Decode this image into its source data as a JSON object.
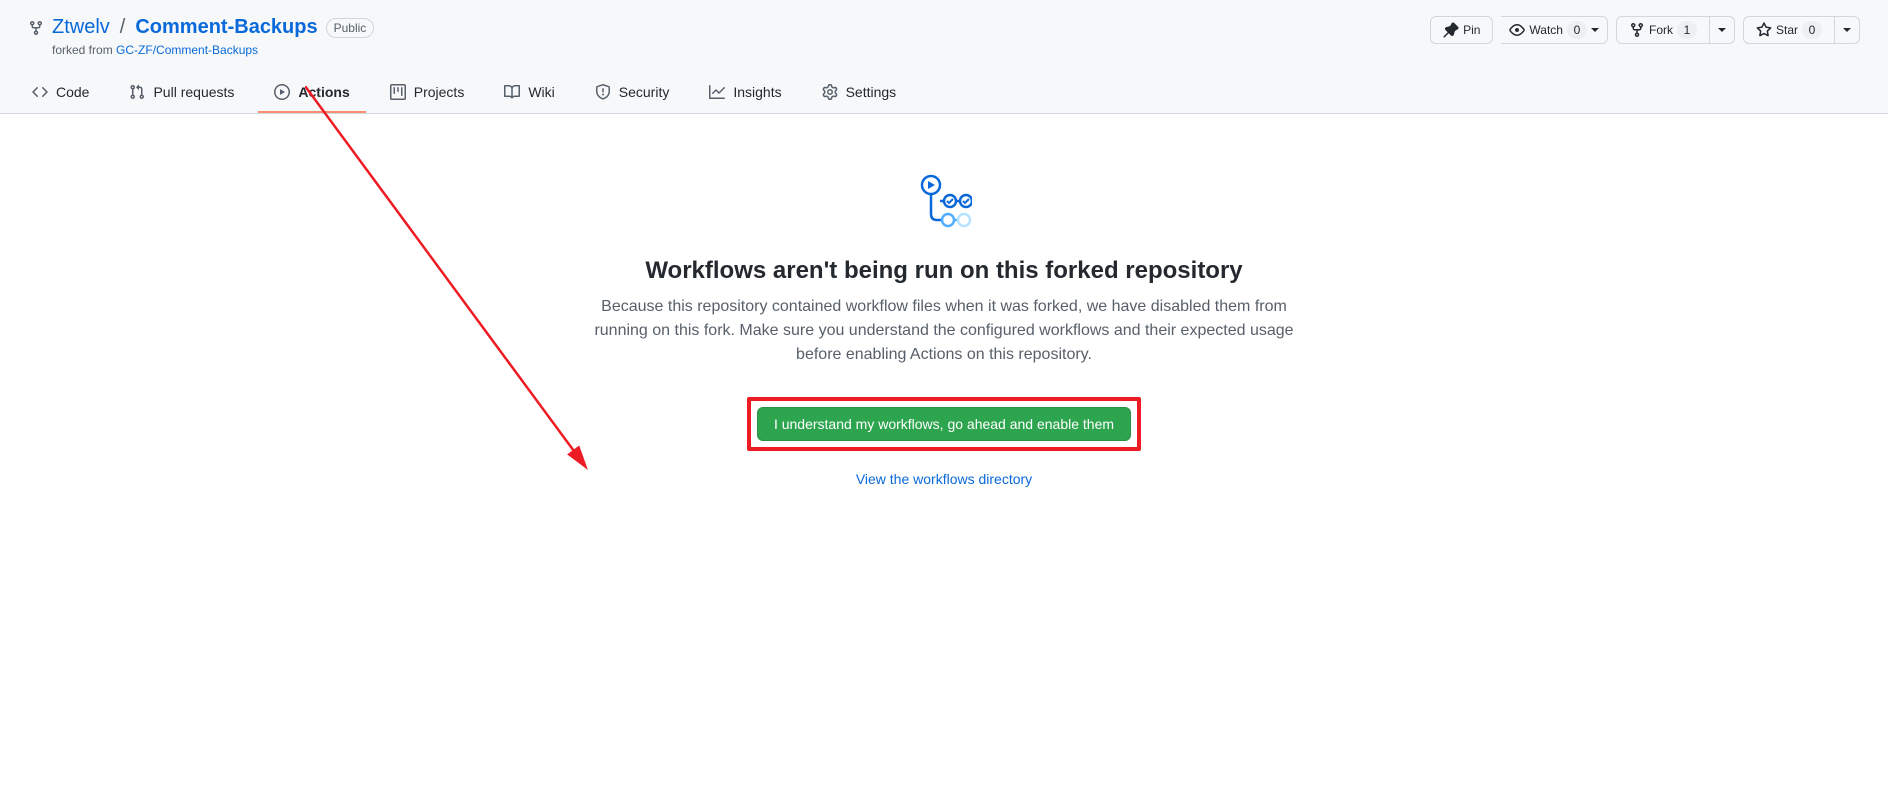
{
  "repo": {
    "owner": "Ztwelv",
    "name": "Comment-Backups",
    "separator": "/",
    "visibility": "Public",
    "forked_prefix": "forked from ",
    "forked_from": "GC-ZF/Comment-Backups"
  },
  "actions": {
    "pin": "Pin",
    "watch": "Watch",
    "watch_count": "0",
    "fork": "Fork",
    "fork_count": "1",
    "star": "Star",
    "star_count": "0"
  },
  "tabs": {
    "code": "Code",
    "pull_requests": "Pull requests",
    "actions": "Actions",
    "projects": "Projects",
    "wiki": "Wiki",
    "security": "Security",
    "insights": "Insights",
    "settings": "Settings"
  },
  "blankslate": {
    "title": "Workflows aren't being run on this forked repository",
    "description": "Because this repository contained workflow files when it was forked, we have disabled them from running on this fork. Make sure you understand the configured workflows and their expected usage before enabling Actions on this repository.",
    "button": "I understand my workflows, go ahead and enable them",
    "link": "View the workflows directory"
  }
}
